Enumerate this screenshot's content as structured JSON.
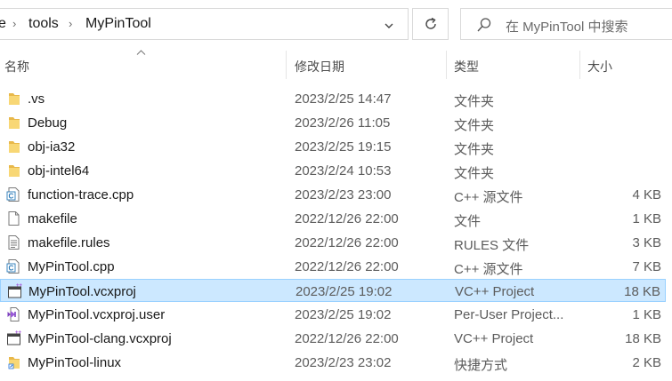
{
  "address": {
    "crumbs": [
      "e",
      "tools",
      "MyPinTool"
    ],
    "separator_icon": "chevron-right-icon",
    "dropdown_icon": "chevron-down-icon"
  },
  "refresh": {
    "icon": "refresh-icon"
  },
  "search": {
    "placeholder": "在 MyPinTool 中搜索",
    "icon": "search-icon"
  },
  "columns": {
    "name": "名称",
    "date": "修改日期",
    "type": "类型",
    "size": "大小",
    "sorted_by": "name"
  },
  "files": [
    {
      "name": ".vs",
      "date": "2023/2/25 14:47",
      "type": "文件夹",
      "size": "",
      "icon": "folder-icon"
    },
    {
      "name": "Debug",
      "date": "2023/2/26 11:05",
      "type": "文件夹",
      "size": "",
      "icon": "folder-icon"
    },
    {
      "name": "obj-ia32",
      "date": "2023/2/25 19:15",
      "type": "文件夹",
      "size": "",
      "icon": "folder-icon"
    },
    {
      "name": "obj-intel64",
      "date": "2023/2/24 10:53",
      "type": "文件夹",
      "size": "",
      "icon": "folder-icon"
    },
    {
      "name": "function-trace.cpp",
      "date": "2023/2/23 23:00",
      "type": "C++ 源文件",
      "size": "4 KB",
      "icon": "cpp-file-icon"
    },
    {
      "name": "makefile",
      "date": "2022/12/26 22:00",
      "type": "文件",
      "size": "1 KB",
      "icon": "file-icon"
    },
    {
      "name": "makefile.rules",
      "date": "2022/12/26 22:00",
      "type": "RULES 文件",
      "size": "3 KB",
      "icon": "text-file-icon"
    },
    {
      "name": "MyPinTool.cpp",
      "date": "2022/12/26 22:00",
      "type": "C++ 源文件",
      "size": "7 KB",
      "icon": "cpp-file-icon"
    },
    {
      "name": "MyPinTool.vcxproj",
      "date": "2023/2/25 19:02",
      "type": "VC++ Project",
      "size": "18 KB",
      "icon": "vcxproj-file-icon",
      "selected": true
    },
    {
      "name": "MyPinTool.vcxproj.user",
      "date": "2023/2/25 19:02",
      "type": "Per-User Project...",
      "size": "1 KB",
      "icon": "vs-user-file-icon"
    },
    {
      "name": "MyPinTool-clang.vcxproj",
      "date": "2022/12/26 22:00",
      "type": "VC++ Project",
      "size": "18 KB",
      "icon": "vcxproj-file-icon"
    },
    {
      "name": "MyPinTool-linux",
      "date": "2023/2/23 23:02",
      "type": "快捷方式",
      "size": "2 KB",
      "icon": "shortcut-folder-icon"
    }
  ],
  "colors": {
    "selection": "#cce8ff",
    "selection_border": "#99d1ff",
    "folder": "#f8d775",
    "accent": "#0078d4"
  }
}
